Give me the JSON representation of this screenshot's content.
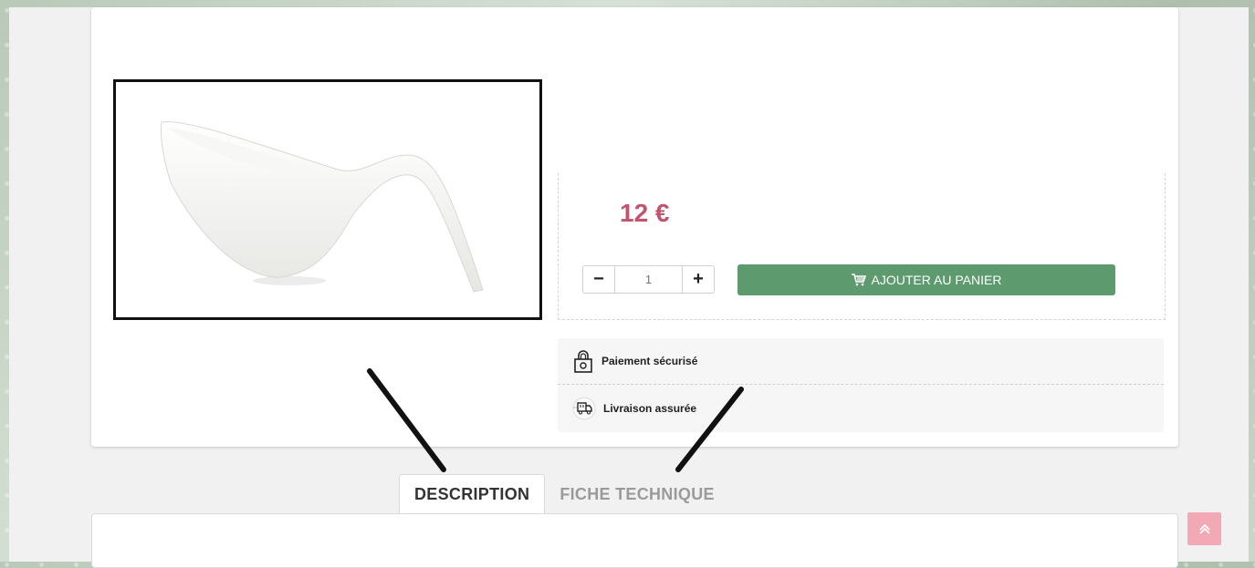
{
  "product": {
    "price": "12 €",
    "quantity": "1",
    "qty_minus": "−",
    "qty_plus": "+",
    "add_to_cart_label": "AJOUTER AU PANIER"
  },
  "reassurance": [
    {
      "label": "Paiement sécurisé",
      "icon": "lock-icon"
    },
    {
      "label": "Livraison assurée",
      "icon": "delivery-truck-icon"
    }
  ],
  "tabs": [
    {
      "label": "DESCRIPTION",
      "active": true
    },
    {
      "label": "FICHE TECHNIQUE",
      "active": false
    }
  ],
  "colors": {
    "price": "#c3536f",
    "cart_button": "#5d9a6e",
    "scroll_top": "#f2a9b5"
  }
}
